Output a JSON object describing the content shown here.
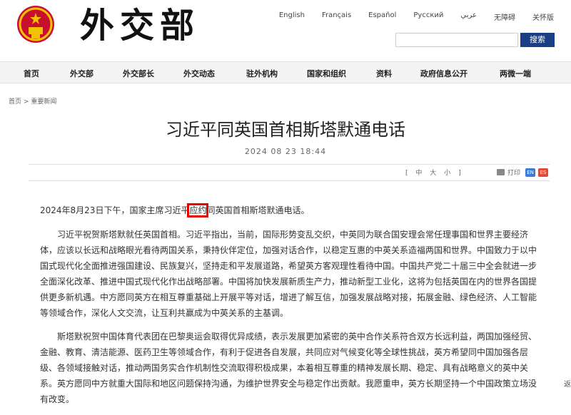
{
  "header": {
    "brand": "外交部",
    "languages": [
      "English",
      "Français",
      "Español",
      "Русский",
      "عربي",
      "无障碍",
      "关怀版"
    ],
    "search": {
      "placeholder": "",
      "button": "搜索"
    }
  },
  "nav": [
    "首页",
    "外交部",
    "外交部长",
    "外交动态",
    "驻外机构",
    "国家和组织",
    "资料",
    "政府信息公开",
    "两微一端"
  ],
  "breadcrumb": [
    "首页",
    "重要新闻"
  ],
  "article": {
    "title": "习近平同英国首相斯塔默通电话",
    "date": "2024 08 23 18:44",
    "toolbar": {
      "font_sizes": [
        "中",
        "大",
        "小"
      ],
      "print": "打印",
      "lang_en": "EN",
      "lang_es": "ES"
    },
    "para1_before": "2024年8月23日下午，国家主席习近平",
    "para1_highlight": "应约",
    "para1_after": "同英国首相斯塔默通电话。",
    "para2": "习近平祝贺斯塔默就任英国首相。习近平指出，当前，国际形势变乱交织，中英同为联合国安理会常任理事国和世界主要经济体，应该以长远和战略眼光看待两国关系，秉持伙伴定位，加强对话合作，以稳定互惠的中英关系造福两国和世界。中国致力于以中国式现代化全面推进强国建设、民族复兴，坚持走和平发展道路，希望英方客观理性看待中国。中国共产党二十届三中全会就进一步全面深化改革、推进中国式现代化作出战略部署。中国将加快发展新质生产力，推动新型工业化，这将为包括英国在内的世界各国提供更多新机遇。中方愿同英方在相互尊重基础上开展平等对话，增进了解互信，加强发展战略对接，拓展金融、绿色经济、人工智能等领域合作，深化人文交流，让互利共赢成为中英关系的主基调。",
    "para3": "斯塔默祝贺中国体育代表团在巴黎奥运会取得优异成绩，表示发展更加紧密的英中合作关系符合双方长远利益，两国加强经贸、金融、教育、清洁能源、医药卫生等领域合作，有利于促进各自发展，共同应对气候变化等全球性挑战，英方希望同中国加强各层级、各领域接触对话，推动两国务实合作机制性交流取得积极成果，本着相互尊重的精神发展长期、稳定、具有战略意义的英中关系。英方愿同中方就重大国际和地区问题保持沟通，为维护世界安全与稳定作出贡献。我愿重申，英方长期坚持一个中国政策立场没有改变。"
  },
  "back_label": "返",
  "colors": {
    "nav_bg": "#f4f4f4",
    "search_btn": "#1a3e86",
    "highlight": "#e60000",
    "en_btn": "#3a7bd5",
    "es_btn": "#e14b3b"
  }
}
